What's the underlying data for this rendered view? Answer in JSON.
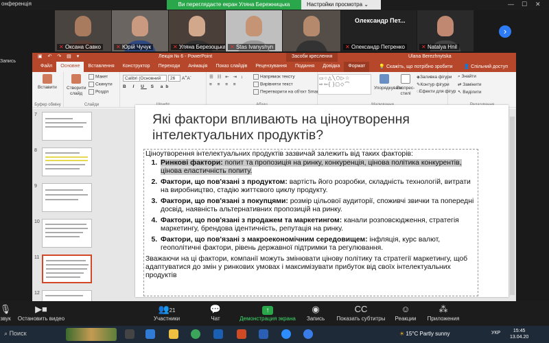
{
  "zoom": {
    "window_title": "онференція",
    "share_message": "Ви переглядаєте екран Уляна Бережницька",
    "view_options": "Настройки просмотра",
    "participants": [
      {
        "name": "Оксана Савко"
      },
      {
        "name": "Юрій Чучук"
      },
      {
        "name": "Уляна Березоцька"
      },
      {
        "name": "Stas Ivanyshyn"
      },
      {
        "name": "Олександр Петренко"
      },
      {
        "name": "Natalya Hnil"
      }
    ],
    "big_name": "Олександр  Пет...",
    "recording": "Запись",
    "controls": [
      {
        "label": "звук"
      },
      {
        "label": "Остановить видео"
      },
      {
        "label": "Участники",
        "count": "21"
      },
      {
        "label": "Чат"
      },
      {
        "label": "Демонстрация экрана"
      },
      {
        "label": "Запись"
      },
      {
        "label": "Показать субтитры"
      },
      {
        "label": "Реакции"
      },
      {
        "label": "Приложения"
      }
    ]
  },
  "ppt": {
    "doc_title": "Лекція № 6  -  PowerPoint",
    "context_tab": "Засоби креслення",
    "user": "Ulana Berezhnytska",
    "tabs": [
      "Файл",
      "Основне",
      "Вставлення",
      "Конструктор",
      "Переходи",
      "Анімація",
      "Показ слайдів",
      "Рецензування",
      "Подання",
      "Довідка",
      "Формат"
    ],
    "tell_me": "Скажіть, що потрібно зробити",
    "share": "Спільний доступ",
    "ribbon": {
      "paste": "Вставити",
      "clipboard": "Буфер обміну",
      "new_slide": "Створити слайд",
      "layout": "Макет",
      "reset": "Скинути",
      "section": "Розділ",
      "slides": "Слайди",
      "font_name": "Calibri (Основний",
      "font_size": "26",
      "font": "Шрифт",
      "text_dir": "Напрямок тексту",
      "align_text": "Вирівняти текст",
      "smartart": "Перетворити на об'єкт SmartArt",
      "paragraph": "Абзац",
      "arrange": "Упорядкувати",
      "quick_styles": "Експрес-стилі",
      "fill": "Заливка фігури",
      "outline": "Контур фігури",
      "effects": "Ефекти для фігур",
      "drawing": "Малювання",
      "find": "Знайти",
      "replace": "Замінити",
      "select": "Виділити",
      "editing": "Редагування"
    },
    "thumb_numbers": [
      "7",
      "8",
      "9",
      "10",
      "11",
      "12"
    ],
    "slide": {
      "title": "Які фактори впливають на ціноутворення інтелектуальних продуктів?",
      "intro": "Ціноутворення інтелектуальних продуктів зазвичай залежить від таких факторів:",
      "items": [
        {
          "head": "Ринкові фактори:",
          "text": " попит та пропозиція на ринку, конкуренція, цінова політика конкурентів, цінова еластичність попиту."
        },
        {
          "head": "Фактори, що пов'язані з продуктом:",
          "text": " вартість його розробки, складність технологій, витрати на виробництво, стадію життєвого циклу продукту."
        },
        {
          "head": "Фактори, що пов'язані з покупцями:",
          "text": " розмір цільової аудиторії, споживчі звички та попередні досвід, наявність альтернативних пропозицій на ринку."
        },
        {
          "head": "Фактори, що пов'язані з продажем та маркетингом:",
          "text": " канали розповсюдження, стратегія маркетингу, брендова ідентичність, репутація на ринку."
        },
        {
          "head": "Фактори, що пов'язані з макроекономічним середовищем:",
          "text": " інфляція, курс валют, геополітичні фактори, рівень державної підтримки та регулювання."
        }
      ],
      "footer": "Зважаючи на ці фактори, компанії можуть змінювати цінову політику та стратегії маркетингу, щоб адаптуватися до змін у ринкових умовах і максимізувати прибуток від своїх інтелектуальних продуктів"
    }
  },
  "taskbar": {
    "search": "Поиск",
    "weather": "15°C  Partly sunny",
    "lang": "УКР",
    "time": "15:45",
    "date": "13.04.20"
  }
}
